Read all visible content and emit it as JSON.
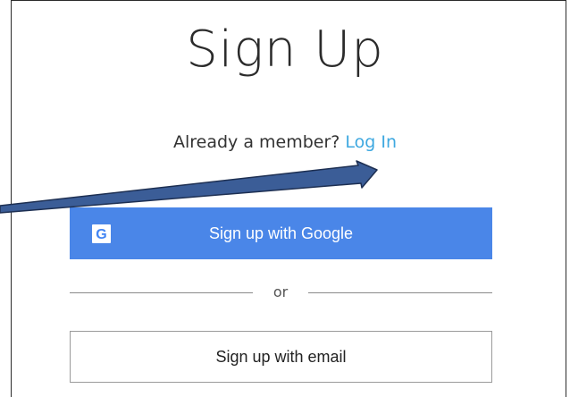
{
  "signup": {
    "title": "Sign Up",
    "member_prompt": "Already a member?",
    "login_link": "Log In",
    "google_button": "Sign up with Google",
    "google_badge_letter": "G",
    "divider_text": "or",
    "email_button": "Sign up with email"
  },
  "colors": {
    "google_button_bg": "#4a86e8",
    "link_color": "#3ea8e0",
    "annotation_arrow_fill": "#3b5d97",
    "annotation_arrow_outline": "#1d2f52"
  },
  "icons": {
    "google_badge": "google-g-icon",
    "annotation": "annotation-arrow-icon"
  }
}
